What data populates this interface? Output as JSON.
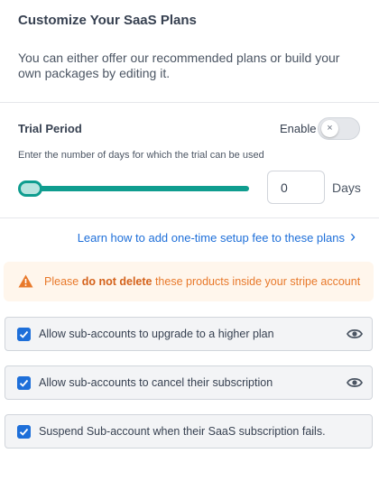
{
  "header": {
    "title": "Customize Your SaaS Plans",
    "description": "You can either offer our recommended plans or build your own packages by editing it."
  },
  "trial": {
    "label": "Trial Period",
    "enable_label": "Enable",
    "enabled": false,
    "toggle_glyph": "×",
    "hint": "Enter the number of days for which the trial can be used",
    "days_value": "0",
    "days_unit": "Days",
    "slider_level": 0
  },
  "setup_link": {
    "text": "Learn how to add one-time setup fee to these plans",
    "icon": "chevron-right-icon"
  },
  "warning": {
    "icon": "warning-triangle-icon",
    "prefix": "Please ",
    "emphasis": "do not delete",
    "suffix": " these products inside your stripe account"
  },
  "options": [
    {
      "label": "Allow sub-accounts to upgrade to a higher plan",
      "checked": true,
      "icon": "eye-icon"
    },
    {
      "label": "Allow sub-accounts to cancel their subscription",
      "checked": true,
      "icon": "eye-icon"
    },
    {
      "label": "Suspend Sub-account when their SaaS subscription fails.",
      "checked": true
    }
  ],
  "colors": {
    "accent_teal": "#0f9d8f",
    "link_blue": "#1e6fd9",
    "warning_orange": "#e8792b",
    "warning_bg": "#fff6ec"
  }
}
